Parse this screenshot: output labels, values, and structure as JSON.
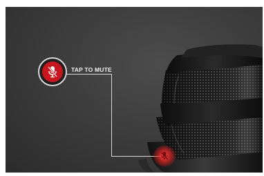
{
  "callout": {
    "label": "TAP TO MUTE"
  },
  "icons": {
    "badge_icon": "microphone-muted-icon",
    "hotspot_icon": "microphone-muted-icon"
  },
  "colors": {
    "background": "#3d3d3d",
    "accent_red": "#c8151e",
    "callout_line": "#d9d9d9",
    "label_text": "#f2f2f2"
  }
}
